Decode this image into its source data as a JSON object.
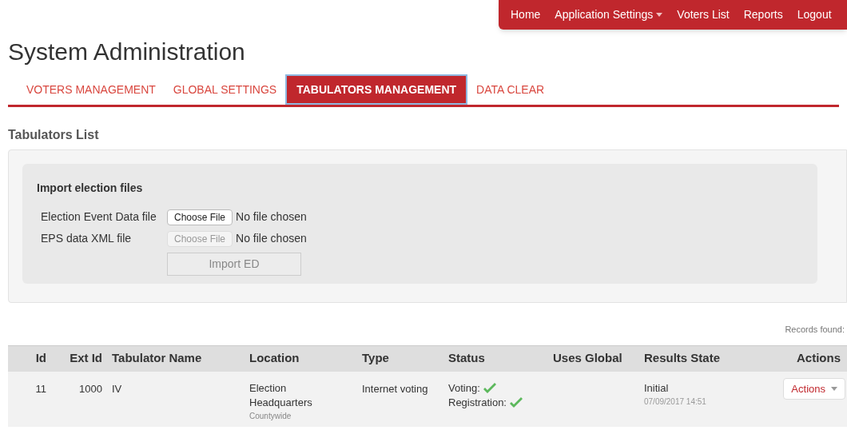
{
  "navbar": {
    "items": [
      {
        "label": "Home",
        "dropdown": false
      },
      {
        "label": "Application Settings",
        "dropdown": true
      },
      {
        "label": "Voters List",
        "dropdown": false
      },
      {
        "label": "Reports",
        "dropdown": false
      },
      {
        "label": "Logout",
        "dropdown": false
      }
    ]
  },
  "title": "System Administration",
  "tabs": [
    {
      "label": "VOTERS MANAGEMENT",
      "selected": false
    },
    {
      "label": "GLOBAL SETTINGS",
      "selected": false
    },
    {
      "label": "TABULATORS MANAGEMENT",
      "selected": true
    },
    {
      "label": "DATA CLEAR",
      "selected": false
    }
  ],
  "section_title": "Tabulators List",
  "import_panel": {
    "title": "Import election files",
    "fields": [
      {
        "label": "Election Event Data file",
        "button": "Choose File",
        "value": "No file chosen",
        "disabled": false
      },
      {
        "label": "EPS data XML file",
        "button": "Choose File",
        "value": "No file chosen",
        "disabled": true
      }
    ],
    "submit": {
      "label": "Import ED",
      "disabled": true
    }
  },
  "records_found": "Records found:",
  "table": {
    "columns": [
      "Id",
      "Ext Id",
      "Tabulator Name",
      "Location",
      "Type",
      "Status",
      "Uses Global",
      "Results State",
      "Actions"
    ],
    "rows": [
      {
        "id": "11",
        "ext_id": "1000",
        "name": "IV",
        "location": "Election Headquarters",
        "location_sub": "Countywide",
        "type": "Internet voting",
        "status": [
          {
            "label": "Voting:",
            "ok": true
          },
          {
            "label": "Registration:",
            "ok": true
          }
        ],
        "uses_global": "",
        "results_state": "Initial",
        "results_time": "07/09/2017 14:51",
        "action": "Actions"
      }
    ]
  }
}
